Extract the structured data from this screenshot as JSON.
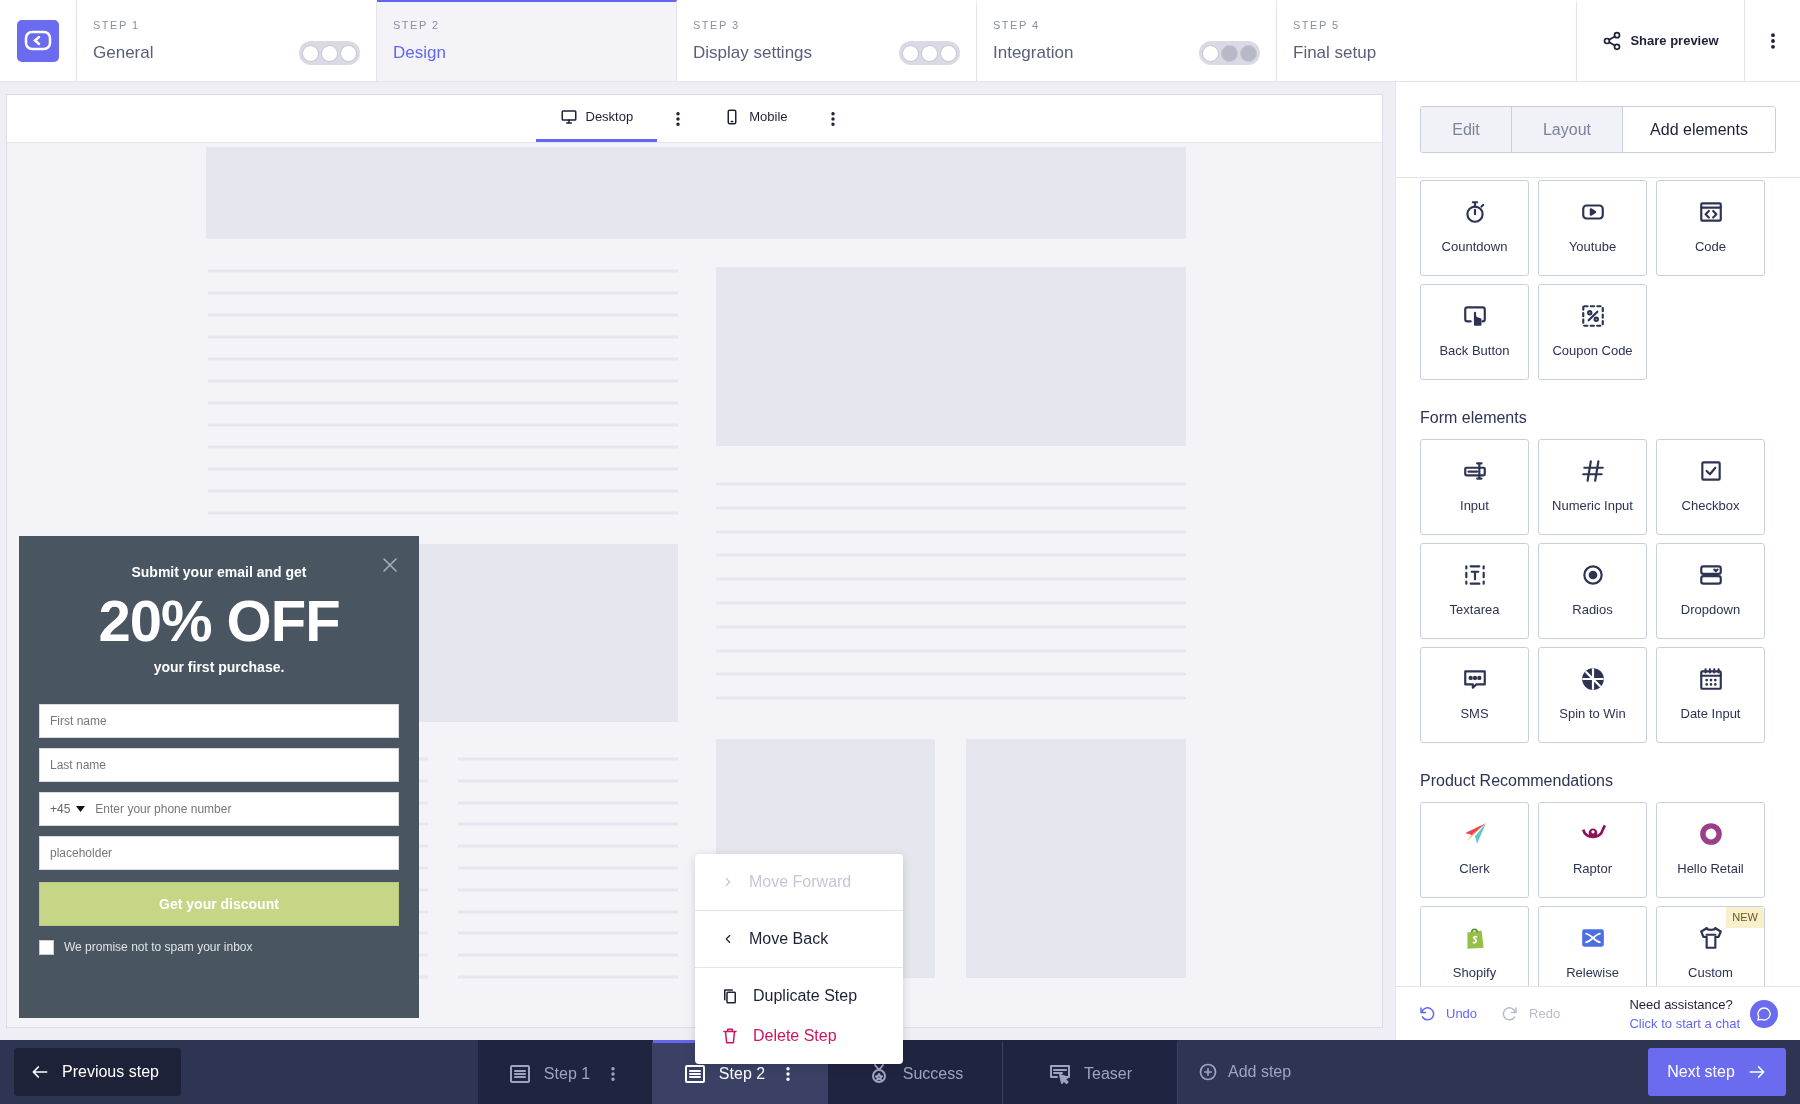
{
  "steps": [
    {
      "number": "STEP 1",
      "label": "General",
      "selected": false,
      "indicators": [
        {
          "filled": false
        },
        {
          "filled": false
        },
        {
          "filled": false
        }
      ]
    },
    {
      "number": "STEP 2",
      "label": "Design",
      "selected": true
    },
    {
      "number": "STEP 3",
      "label": "Display settings",
      "selected": false,
      "indicators": [
        {
          "filled": false
        },
        {
          "filled": false
        },
        {
          "filled": false
        }
      ]
    },
    {
      "number": "STEP 4",
      "label": "Integration",
      "selected": false,
      "indicators": [
        {
          "filled": false
        },
        {
          "filled": true
        },
        {
          "filled": true
        }
      ]
    },
    {
      "number": "STEP 5",
      "label": "Final setup",
      "selected": false
    }
  ],
  "share_button": "Share preview",
  "device_tabs": [
    {
      "label": "Desktop",
      "selected": true
    },
    {
      "label": "Mobile",
      "selected": false
    }
  ],
  "popup": {
    "intro": "Submit your email and get",
    "headline": "20% OFF",
    "subline": "your first purchase.",
    "fields": [
      {
        "kind": "text",
        "placeholder": "First name"
      },
      {
        "kind": "text",
        "placeholder": "Last name"
      },
      {
        "kind": "phone",
        "code": "+45",
        "placeholder": "Enter your phone number"
      },
      {
        "kind": "text",
        "placeholder": "placeholder"
      }
    ],
    "button": "Get your discount",
    "consent": {
      "label": "We promise not to spam your inbox",
      "checked": false
    }
  },
  "context_menu": [
    [
      {
        "label": "Move Forward",
        "disabled": true,
        "kind": "forward"
      }
    ],
    [
      {
        "label": "Move Back",
        "disabled": false,
        "kind": "back"
      }
    ],
    [
      {
        "label": "Duplicate Step",
        "disabled": false,
        "kind": "duplicate"
      },
      {
        "label": "Delete Step",
        "disabled": false,
        "kind": "delete"
      }
    ]
  ],
  "panel_tabs": [
    {
      "label": "Edit",
      "selected": false
    },
    {
      "label": "Layout",
      "selected": false
    },
    {
      "label": "Add elements",
      "selected": true
    }
  ],
  "sections": [
    {
      "items": [
        {
          "label": "Countdown"
        },
        {
          "label": "Youtube"
        },
        {
          "label": "Code"
        },
        {
          "label": "Back Button"
        },
        {
          "label": "Coupon Code"
        }
      ]
    },
    {
      "title": "Form elements",
      "items": [
        {
          "label": "Input"
        },
        {
          "label": "Numeric Input"
        },
        {
          "label": "Checkbox"
        },
        {
          "label": "Textarea"
        },
        {
          "label": "Radios"
        },
        {
          "label": "Dropdown"
        },
        {
          "label": "SMS"
        },
        {
          "label": "Spin to Win"
        },
        {
          "label": "Date Input"
        }
      ]
    },
    {
      "title": "Product Recommendations",
      "items": [
        {
          "label": "Clerk"
        },
        {
          "label": "Raptor"
        },
        {
          "label": "Hello Retail"
        },
        {
          "label": "Shopify"
        },
        {
          "label": "Relewise"
        },
        {
          "label": "Custom",
          "badge": "NEW"
        }
      ]
    }
  ],
  "history": [
    {
      "label": "Undo",
      "disabled": false
    },
    {
      "label": "Redo",
      "disabled": true
    }
  ],
  "help": {
    "title": "Need assistance?",
    "link": "Click to start a chat"
  },
  "previous_button": "Previous step",
  "step_tabs": [
    {
      "kind": "step",
      "label": "Step 1",
      "selected": false,
      "has_menu": true
    },
    {
      "kind": "step",
      "label": "Step 2",
      "selected": true,
      "has_menu": true
    },
    {
      "kind": "success",
      "label": "Success",
      "selected": false,
      "has_menu": false
    },
    {
      "kind": "teaser",
      "label": "Teaser",
      "selected": false,
      "has_menu": false
    },
    {
      "kind": "add",
      "label": "Add step"
    }
  ],
  "next_button": "Next step"
}
